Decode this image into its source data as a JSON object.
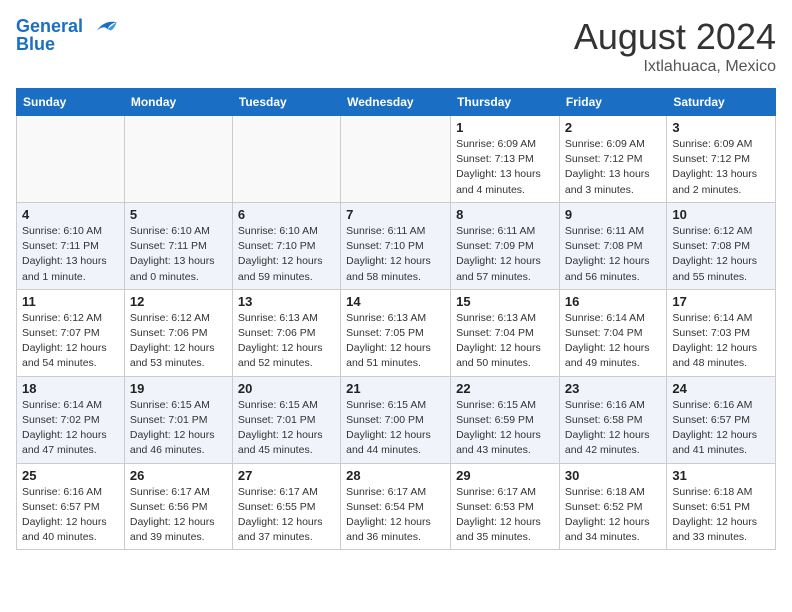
{
  "header": {
    "logo_line1": "General",
    "logo_line2": "Blue",
    "month_year": "August 2024",
    "location": "Ixtlahuaca, Mexico"
  },
  "weekdays": [
    "Sunday",
    "Monday",
    "Tuesday",
    "Wednesday",
    "Thursday",
    "Friday",
    "Saturday"
  ],
  "weeks": [
    [
      {
        "day": "",
        "info": ""
      },
      {
        "day": "",
        "info": ""
      },
      {
        "day": "",
        "info": ""
      },
      {
        "day": "",
        "info": ""
      },
      {
        "day": "1",
        "info": "Sunrise: 6:09 AM\nSunset: 7:13 PM\nDaylight: 13 hours\nand 4 minutes."
      },
      {
        "day": "2",
        "info": "Sunrise: 6:09 AM\nSunset: 7:12 PM\nDaylight: 13 hours\nand 3 minutes."
      },
      {
        "day": "3",
        "info": "Sunrise: 6:09 AM\nSunset: 7:12 PM\nDaylight: 13 hours\nand 2 minutes."
      }
    ],
    [
      {
        "day": "4",
        "info": "Sunrise: 6:10 AM\nSunset: 7:11 PM\nDaylight: 13 hours\nand 1 minute."
      },
      {
        "day": "5",
        "info": "Sunrise: 6:10 AM\nSunset: 7:11 PM\nDaylight: 13 hours\nand 0 minutes."
      },
      {
        "day": "6",
        "info": "Sunrise: 6:10 AM\nSunset: 7:10 PM\nDaylight: 12 hours\nand 59 minutes."
      },
      {
        "day": "7",
        "info": "Sunrise: 6:11 AM\nSunset: 7:10 PM\nDaylight: 12 hours\nand 58 minutes."
      },
      {
        "day": "8",
        "info": "Sunrise: 6:11 AM\nSunset: 7:09 PM\nDaylight: 12 hours\nand 57 minutes."
      },
      {
        "day": "9",
        "info": "Sunrise: 6:11 AM\nSunset: 7:08 PM\nDaylight: 12 hours\nand 56 minutes."
      },
      {
        "day": "10",
        "info": "Sunrise: 6:12 AM\nSunset: 7:08 PM\nDaylight: 12 hours\nand 55 minutes."
      }
    ],
    [
      {
        "day": "11",
        "info": "Sunrise: 6:12 AM\nSunset: 7:07 PM\nDaylight: 12 hours\nand 54 minutes."
      },
      {
        "day": "12",
        "info": "Sunrise: 6:12 AM\nSunset: 7:06 PM\nDaylight: 12 hours\nand 53 minutes."
      },
      {
        "day": "13",
        "info": "Sunrise: 6:13 AM\nSunset: 7:06 PM\nDaylight: 12 hours\nand 52 minutes."
      },
      {
        "day": "14",
        "info": "Sunrise: 6:13 AM\nSunset: 7:05 PM\nDaylight: 12 hours\nand 51 minutes."
      },
      {
        "day": "15",
        "info": "Sunrise: 6:13 AM\nSunset: 7:04 PM\nDaylight: 12 hours\nand 50 minutes."
      },
      {
        "day": "16",
        "info": "Sunrise: 6:14 AM\nSunset: 7:04 PM\nDaylight: 12 hours\nand 49 minutes."
      },
      {
        "day": "17",
        "info": "Sunrise: 6:14 AM\nSunset: 7:03 PM\nDaylight: 12 hours\nand 48 minutes."
      }
    ],
    [
      {
        "day": "18",
        "info": "Sunrise: 6:14 AM\nSunset: 7:02 PM\nDaylight: 12 hours\nand 47 minutes."
      },
      {
        "day": "19",
        "info": "Sunrise: 6:15 AM\nSunset: 7:01 PM\nDaylight: 12 hours\nand 46 minutes."
      },
      {
        "day": "20",
        "info": "Sunrise: 6:15 AM\nSunset: 7:01 PM\nDaylight: 12 hours\nand 45 minutes."
      },
      {
        "day": "21",
        "info": "Sunrise: 6:15 AM\nSunset: 7:00 PM\nDaylight: 12 hours\nand 44 minutes."
      },
      {
        "day": "22",
        "info": "Sunrise: 6:15 AM\nSunset: 6:59 PM\nDaylight: 12 hours\nand 43 minutes."
      },
      {
        "day": "23",
        "info": "Sunrise: 6:16 AM\nSunset: 6:58 PM\nDaylight: 12 hours\nand 42 minutes."
      },
      {
        "day": "24",
        "info": "Sunrise: 6:16 AM\nSunset: 6:57 PM\nDaylight: 12 hours\nand 41 minutes."
      }
    ],
    [
      {
        "day": "25",
        "info": "Sunrise: 6:16 AM\nSunset: 6:57 PM\nDaylight: 12 hours\nand 40 minutes."
      },
      {
        "day": "26",
        "info": "Sunrise: 6:17 AM\nSunset: 6:56 PM\nDaylight: 12 hours\nand 39 minutes."
      },
      {
        "day": "27",
        "info": "Sunrise: 6:17 AM\nSunset: 6:55 PM\nDaylight: 12 hours\nand 37 minutes."
      },
      {
        "day": "28",
        "info": "Sunrise: 6:17 AM\nSunset: 6:54 PM\nDaylight: 12 hours\nand 36 minutes."
      },
      {
        "day": "29",
        "info": "Sunrise: 6:17 AM\nSunset: 6:53 PM\nDaylight: 12 hours\nand 35 minutes."
      },
      {
        "day": "30",
        "info": "Sunrise: 6:18 AM\nSunset: 6:52 PM\nDaylight: 12 hours\nand 34 minutes."
      },
      {
        "day": "31",
        "info": "Sunrise: 6:18 AM\nSunset: 6:51 PM\nDaylight: 12 hours\nand 33 minutes."
      }
    ]
  ]
}
